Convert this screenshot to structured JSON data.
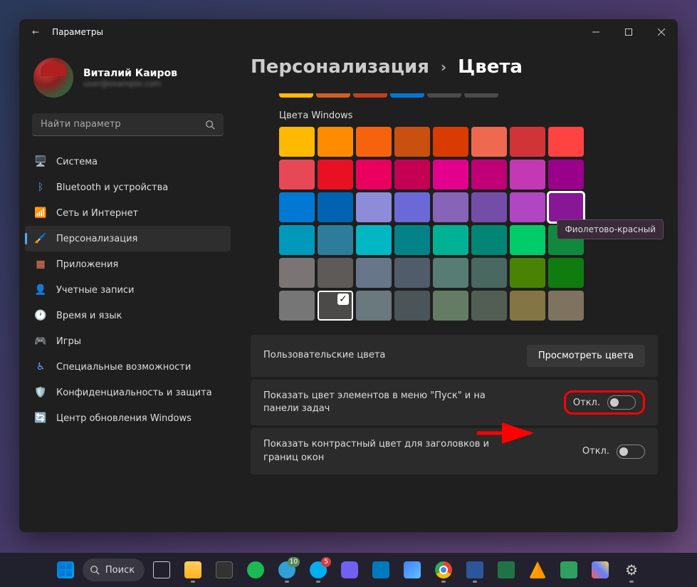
{
  "titlebar": {
    "back": "←",
    "title": "Параметры"
  },
  "profile": {
    "name": "Виталий Каиров",
    "email": "user@example.com"
  },
  "search": {
    "placeholder": "Найти параметр"
  },
  "nav": [
    {
      "icon": "🖥️",
      "label": "Система",
      "color": "#4aa0ff"
    },
    {
      "icon": "ᛒ",
      "label": "Bluetooth и устройства",
      "color": "#4aa0ff"
    },
    {
      "icon": "📶",
      "label": "Сеть и Интернет",
      "color": "#40c0d0"
    },
    {
      "icon": "🖌️",
      "label": "Персонализация",
      "color": "#a080ff",
      "active": true
    },
    {
      "icon": "▦",
      "label": "Приложения",
      "color": "#ff8060"
    },
    {
      "icon": "👤",
      "label": "Учетные записи",
      "color": "#60d090"
    },
    {
      "icon": "🕐",
      "label": "Время и язык",
      "color": "#d0d0d0"
    },
    {
      "icon": "🎮",
      "label": "Игры",
      "color": "#60d090"
    },
    {
      "icon": "♿",
      "label": "Специальные возможности",
      "color": "#60a0ff"
    },
    {
      "icon": "🛡️",
      "label": "Конфиденциальность и защита",
      "color": "#ffd060"
    },
    {
      "icon": "🔄",
      "label": "Центр обновления Windows",
      "color": "#40a0ff"
    }
  ],
  "breadcrumb": {
    "parent": "Персонализация",
    "chev": "›",
    "current": "Цвета"
  },
  "section_label": "Цвета Windows",
  "top_row": [
    "#ffb900",
    "#d06020",
    "#c04020",
    "#0078d4",
    "#4a4a4a",
    "#4a4a4a"
  ],
  "colors": [
    [
      "#ffb900",
      "#ff8c00",
      "#f7630c",
      "#ca5010",
      "#da3b01",
      "#ef6950",
      "#d13438",
      "#ff4343"
    ],
    [
      "#e74856",
      "#e81123",
      "#ea005e",
      "#c30052",
      "#e3008c",
      "#bf0077",
      "#c239b3",
      "#9a0089"
    ],
    [
      "#0078d4",
      "#0063b1",
      "#8e8cd8",
      "#6b69d6",
      "#8764b8",
      "#744da9",
      "#b146c2",
      "#881798"
    ],
    [
      "#0099bc",
      "#2d7d9a",
      "#00b7c3",
      "#038387",
      "#00b294",
      "#018574",
      "#00cc6a",
      "#10893e"
    ],
    [
      "#7a7574",
      "#5d5a58",
      "#68768a",
      "#515c6b",
      "#567c73",
      "#486860",
      "#498205",
      "#107c10"
    ],
    [
      "#767676",
      "#4c4a48",
      "#69797e",
      "#4a5459",
      "#647c64",
      "#525e54",
      "#847545",
      "#7e735f"
    ]
  ],
  "selected_color": {
    "row": 2,
    "col": 7
  },
  "checked_color": {
    "row": 5,
    "col": 1
  },
  "tooltip": "Фиолетово-красный",
  "settings": {
    "custom_colors": {
      "label": "Пользовательские цвета",
      "button": "Просмотреть цвета"
    },
    "accent_start": {
      "label": "Показать цвет элементов в меню \"Пуск\" и на панели задач",
      "state": "Откл."
    },
    "accent_title": {
      "label": "Показать контрастный цвет для заголовков и границ окон",
      "state": "Откл."
    }
  },
  "taskbar": {
    "search": "Поиск",
    "badges": {
      "telegram": "10",
      "skype": "5"
    }
  }
}
